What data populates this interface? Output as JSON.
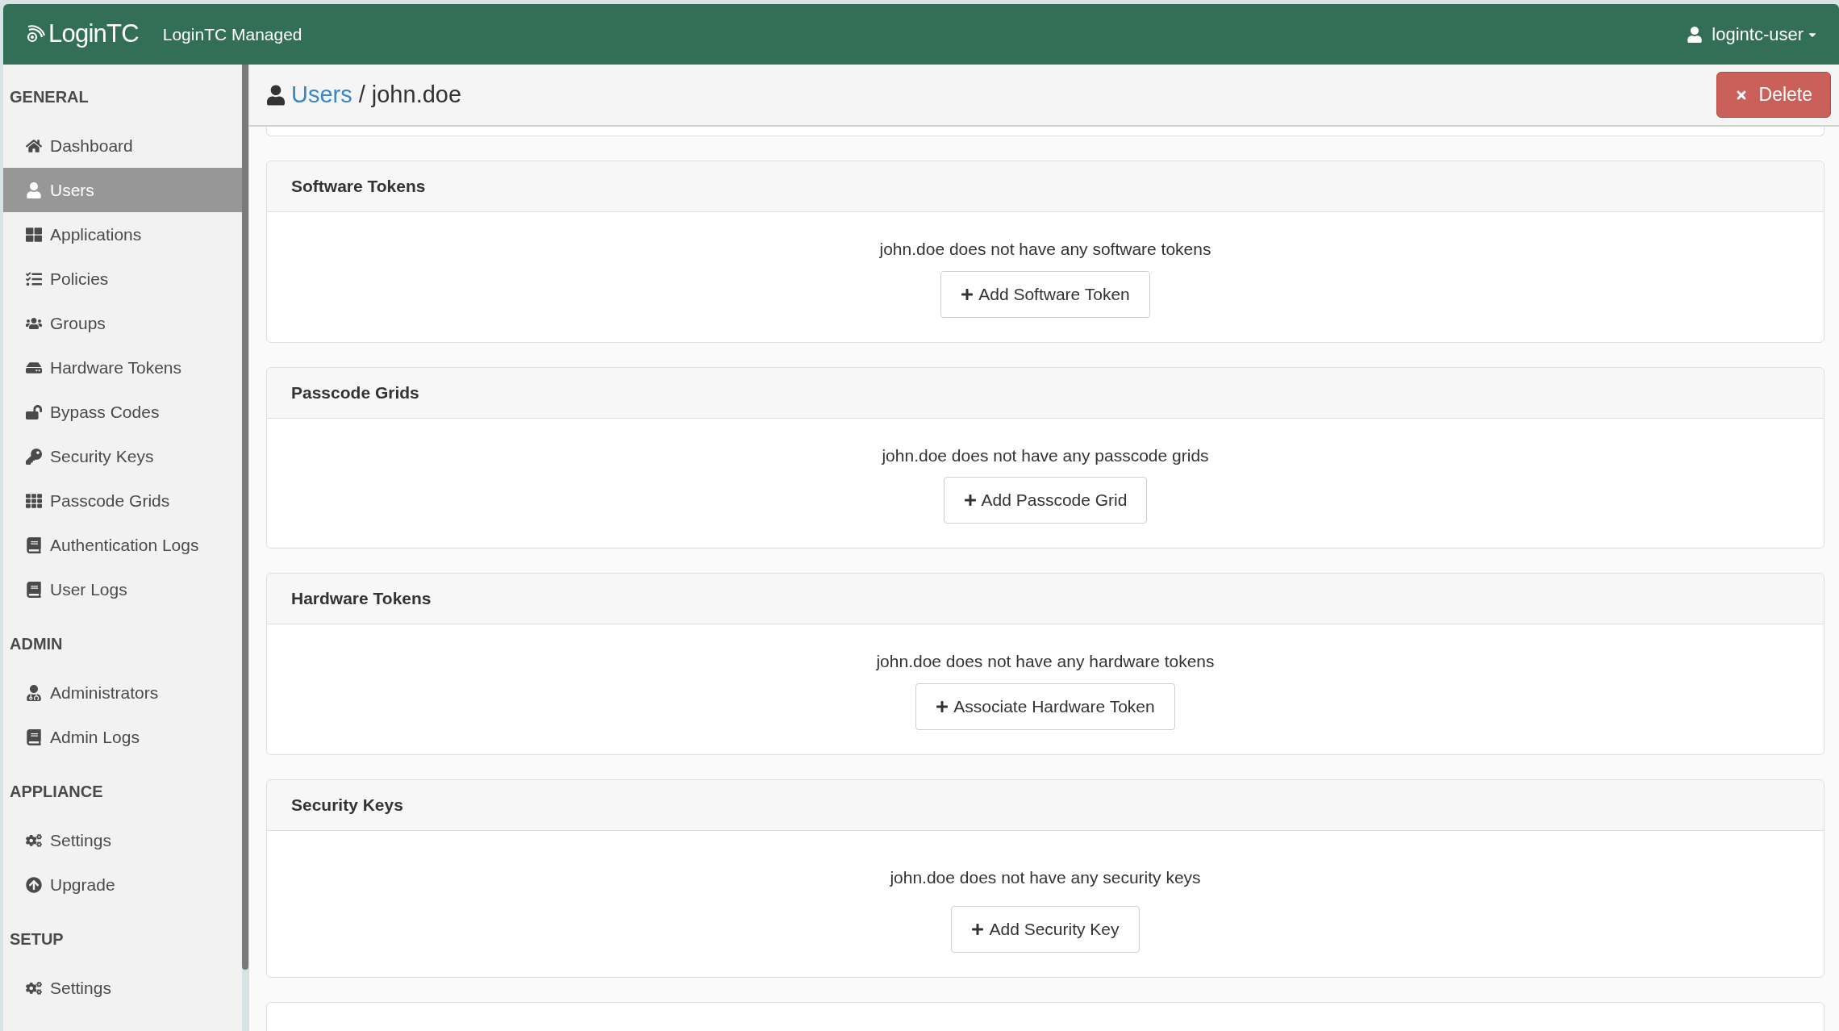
{
  "topbar": {
    "logo": "Login**TC**",
    "product": "LoginTC Managed",
    "user": "logintc-user"
  },
  "sidebar": {
    "sections": [
      {
        "title": "GENERAL",
        "items": [
          {
            "label": "Dashboard",
            "selected": false
          },
          {
            "label": "Users",
            "selected": true
          },
          {
            "label": "Applications",
            "selected": false
          },
          {
            "label": "Policies",
            "selected": false
          },
          {
            "label": "Groups",
            "selected": false
          },
          {
            "label": "Hardware Tokens",
            "selected": false
          },
          {
            "label": "Bypass Codes",
            "selected": false
          },
          {
            "label": "Security Keys",
            "selected": false
          },
          {
            "label": "Passcode Grids",
            "selected": false
          },
          {
            "label": "Authentication Logs",
            "selected": false
          },
          {
            "label": "User Logs",
            "selected": false
          }
        ]
      },
      {
        "title": "ADMIN",
        "items": [
          {
            "label": "Administrators",
            "selected": false
          },
          {
            "label": "Admin Logs",
            "selected": false
          }
        ]
      },
      {
        "title": "APPLIANCE",
        "items": [
          {
            "label": "Settings",
            "selected": false
          },
          {
            "label": "Upgrade",
            "selected": false
          }
        ]
      },
      {
        "title": "SETUP",
        "items": [
          {
            "label": "Settings",
            "selected": false
          }
        ]
      }
    ]
  },
  "header": {
    "breadcrumb_link": "Users",
    "separator": "/",
    "current": "john.doe",
    "delete_button": "Delete"
  },
  "cards": [
    {
      "title": "Software Tokens",
      "message": "john.doe does not have any software tokens",
      "button": "Add Software Token"
    },
    {
      "title": "Passcode Grids",
      "message": "john.doe does not have any passcode grids",
      "button": "Add Passcode Grid"
    },
    {
      "title": "Hardware Tokens",
      "message": "john.doe does not have any hardware tokens",
      "button": "Associate Hardware Token"
    },
    {
      "title": "Security Keys",
      "message": "john.doe does not have any security keys",
      "button": "Add Security Key"
    }
  ]
}
